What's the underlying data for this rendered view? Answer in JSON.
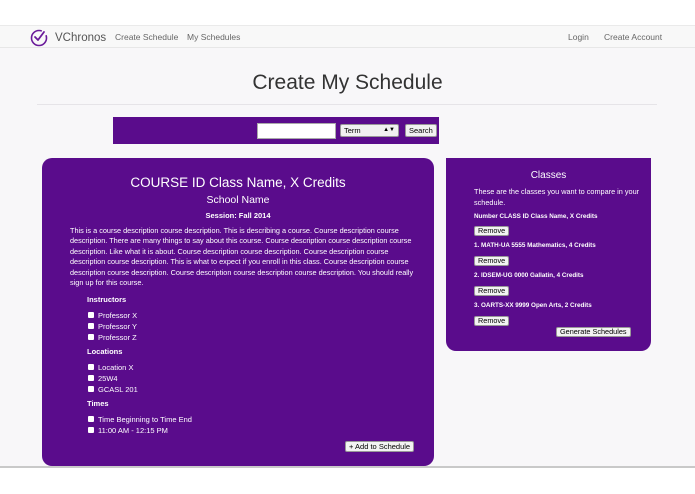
{
  "nav": {
    "brand": "VChronos",
    "links_left": [
      "Create Schedule",
      "My Schedules"
    ],
    "login": "Login",
    "create_account": "Create Account"
  },
  "page": {
    "title": "Create My Schedule"
  },
  "search": {
    "value": "",
    "term_selected": "Term",
    "button": "Search"
  },
  "course": {
    "title": "COURSE ID Class Name, X Credits",
    "school": "School Name",
    "session": "Session: Fall 2014",
    "description": "This is a course description course description. This is describing a course. Course description course description. There are many things to say about this course. Course description course description course description. Like what it is about. Course description course description. Course description course description course description. This is what to expect if you enroll in this class. Course description course description course description. Course description course description course description. You should really sign up for this course.",
    "instructors_label": "Instructors",
    "instructors": [
      "Professor X",
      "Professor Y",
      "Professor Z"
    ],
    "locations_label": "Locations",
    "locations": [
      "Location X",
      "25W4",
      "GCASL 201"
    ],
    "times_label": "Times",
    "times": [
      "Time Beginning to Time End",
      "11:00 AM - 12:15 PM"
    ],
    "add_button": "+ Add to Schedule"
  },
  "classes": {
    "title": "Classes",
    "description": "These are the classes you want to compare in your schedule.",
    "entries": [
      "Number CLASS ID Class Name, X Credits",
      "1. MATH-UA 5555 Mathematics, 4 Credits",
      "2. IDSEM-UG 0000 Gallatin, 4 Credits",
      "3. OARTS-XX 9999 Open Arts, 2 Credits"
    ],
    "remove_label": "Remove",
    "generate_button": "Generate Schedules"
  },
  "colors": {
    "panel": "#5a0c8c",
    "background": "#f8f7f9"
  }
}
